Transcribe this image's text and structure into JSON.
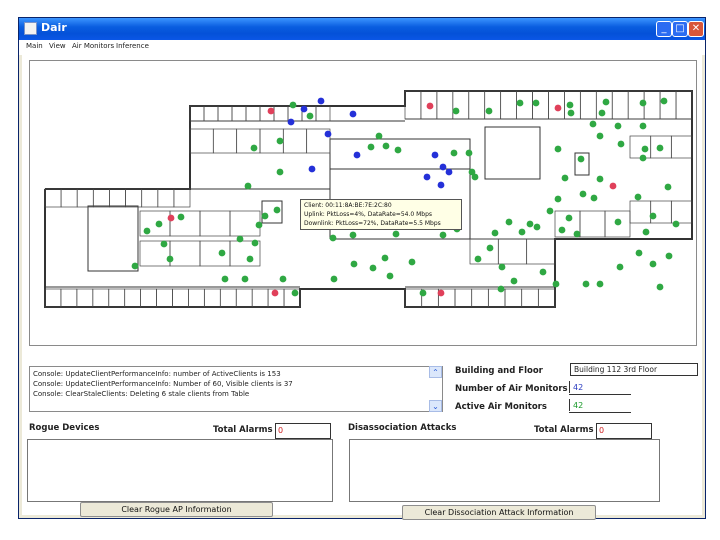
{
  "window": {
    "title": "Dair",
    "controls": {
      "minimize": "_",
      "maximize": "□",
      "close": "✕"
    }
  },
  "menu": [
    "Main",
    "View",
    "Air Monitors",
    "Inference"
  ],
  "map": {
    "tooltip": [
      "Client: 00:11:8A:BE:7E:2C:80",
      "Uplink: PktLoss=4%, DataRate=54.0 Mbps",
      "Downlink: PktLoss=72%, DataRate=5.5 Mbps"
    ],
    "legend_colors": {
      "green": "#2fa843",
      "blue": "#2430d8",
      "red": "#e0405a"
    }
  },
  "console": {
    "lines": [
      "Console: UpdateClientPerformanceInfo: number of ActiveClients is 153",
      "Console: UpdateClientPerformanceInfo: Number of 60, Visible clients is 37",
      "Console: ClearStaleClients: Deleting 6 stale clients from Table"
    ],
    "scroll_up": "⌃",
    "scroll_down": "⌄"
  },
  "info": {
    "building_label": "Building and Floor",
    "building_value": "Building 112 3rd Floor",
    "monitors_label": "Number of Air Monitors",
    "monitors_value": "42",
    "active_label": "Active Air Monitors",
    "active_value": "42"
  },
  "rogue": {
    "title": "Rogue Devices",
    "total_label": "Total Alarms",
    "total_value": "0",
    "button": "Clear Rogue AP Information"
  },
  "disassoc": {
    "title": "Disassociation Attacks",
    "total_label": "Total Alarms",
    "total_value": "0",
    "button": "Clear Dissociation Attack Information"
  }
}
